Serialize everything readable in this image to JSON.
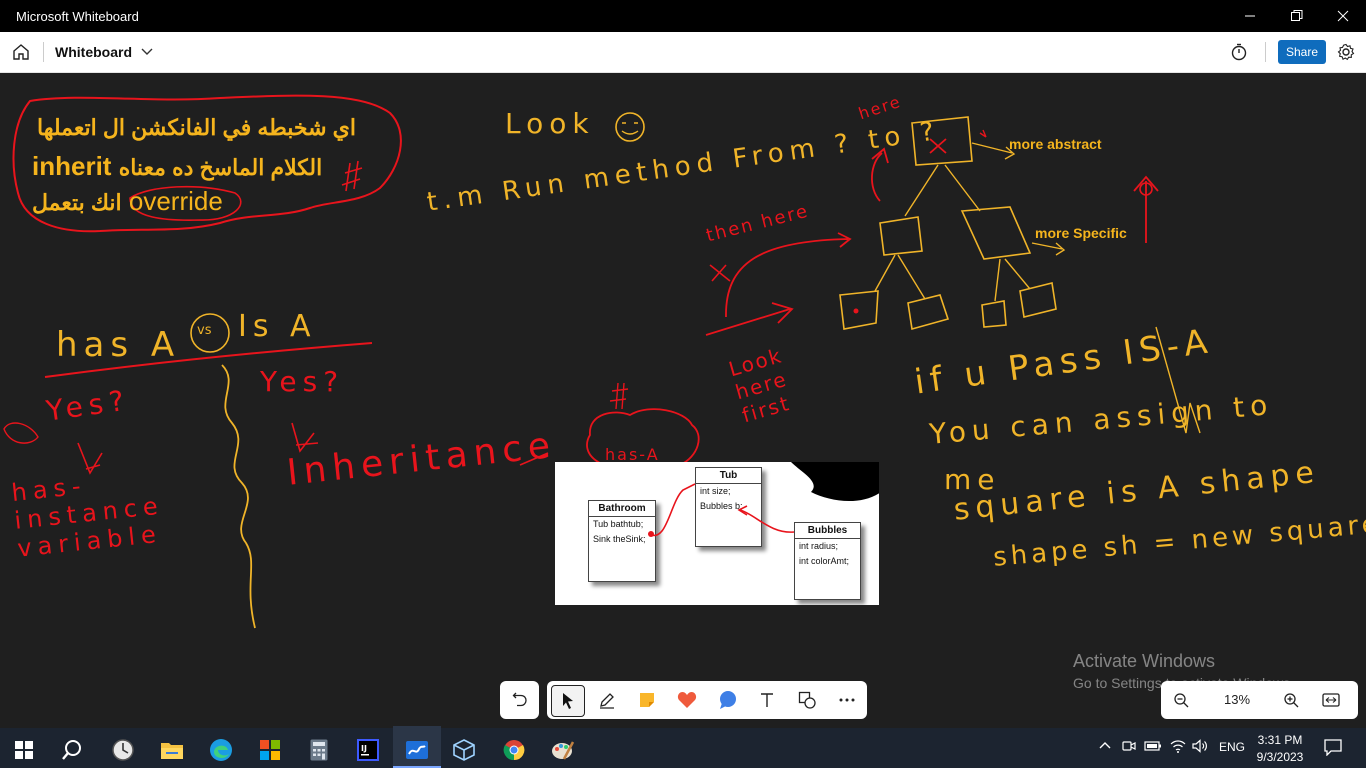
{
  "window": {
    "title": "Microsoft Whiteboard",
    "controls": [
      "minimize",
      "maximize",
      "close"
    ]
  },
  "appbar": {
    "board_name": "Whiteboard",
    "share_label": "Share"
  },
  "canvas": {
    "arabic_note": {
      "line1": "اي شخبطه في الفانكشن ال اتعملها",
      "line2_ar": "الكلام الماسخ ده معناه",
      "line2_en": "inherit",
      "line3_ar": "انك بتعمل",
      "line3_en": "override"
    },
    "typed_labels": {
      "more_abstract": "more abstract",
      "more_specific": "more Specific"
    },
    "handwriting": {
      "look": "Look",
      "run_method": "t.m Run method From ? to ?",
      "here": "here",
      "then_here": "then here",
      "look_here_first": "Look here first",
      "has_a": "has A",
      "vs": "vs",
      "is_a": "Is A",
      "yes_left": "Yes?",
      "yes_right": "Yes?",
      "has_instance_variable": "has-instance variable",
      "inheritance": "Inheritance",
      "has_a_cloud": "has-A",
      "if_pass_isa": "if u Pass IS-A",
      "you_can_assign": "You can assign to",
      "me": "me",
      "square_is_a_shape": "square is A shape",
      "shape_code": "shape sh = new square();"
    },
    "uml": {
      "classes": [
        {
          "name": "Bathroom",
          "fields": [
            "Tub bathtub;",
            "Sink theSink;"
          ]
        },
        {
          "name": "Tub",
          "fields": [
            "int size;",
            "Bubbles b;"
          ]
        },
        {
          "name": "Bubbles",
          "fields": [
            "int radius;",
            "int colorAmt;"
          ]
        }
      ]
    },
    "watermark": {
      "title": "Activate Windows",
      "subtitle": "Go to Settings to activate Windows."
    }
  },
  "toolbar": {
    "tools": [
      "undo-icon",
      "select-icon",
      "pen-icon",
      "sticky-note-icon",
      "reaction-icon",
      "comment-icon",
      "text-icon",
      "shapes-icon",
      "more-icon"
    ],
    "zoom_level": "13%"
  },
  "taskbar": {
    "language": "ENG",
    "time": "3:31 PM",
    "date": "9/3/2023"
  },
  "colors": {
    "ink_yellow": "#f0b429",
    "ink_red": "#e8141c",
    "share_blue": "#0f6cbd",
    "canvas_bg": "#1f1f1f"
  }
}
